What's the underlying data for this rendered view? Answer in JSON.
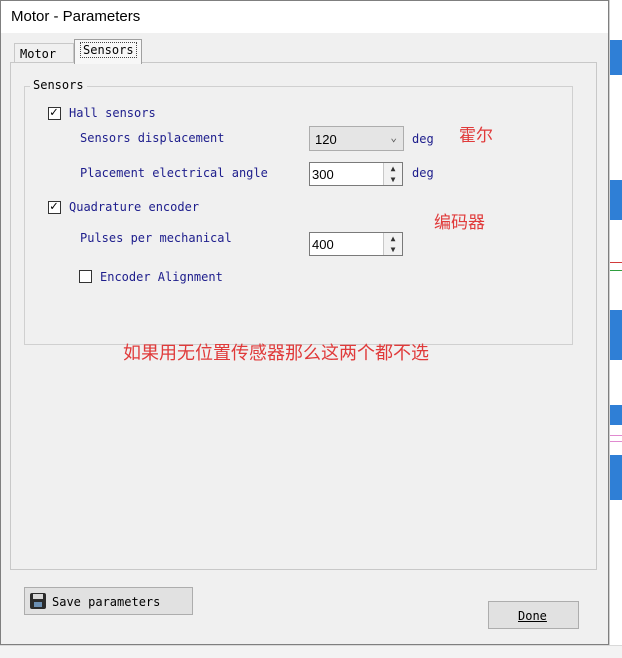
{
  "window": {
    "title": "Motor - Parameters"
  },
  "tabs": [
    {
      "label": "Motor",
      "selected": false
    },
    {
      "label": "Sensors",
      "selected": true
    }
  ],
  "sensors_group": {
    "label": "Sensors",
    "hall_sensors": {
      "label": "Hall sensors",
      "checked": true
    },
    "sensors_displacement": {
      "label": "Sensors displacement",
      "value": "120",
      "unit": "deg"
    },
    "placement_electrical_angle": {
      "label": "Placement electrical angle",
      "value": "300",
      "unit": "deg"
    },
    "quadrature_encoder": {
      "label": "Quadrature encoder",
      "checked": true
    },
    "pulses_per_mechanical": {
      "label": "Pulses per mechanical",
      "value": "400"
    },
    "encoder_alignment": {
      "label": "Encoder Alignment",
      "checked": false
    }
  },
  "annotations": {
    "hall": "霍尔",
    "encoder": "编码器",
    "note": "如果用无位置传感器那么这两个都不选",
    "color": "#e03a3a"
  },
  "buttons": {
    "save": "Save parameters",
    "done": "Done"
  },
  "icons": {
    "save": "floppy-disk-icon",
    "combo": "chevron-down-icon",
    "spin_up": "spin-up-arrow-icon",
    "spin_down": "spin-down-arrow-icon"
  }
}
